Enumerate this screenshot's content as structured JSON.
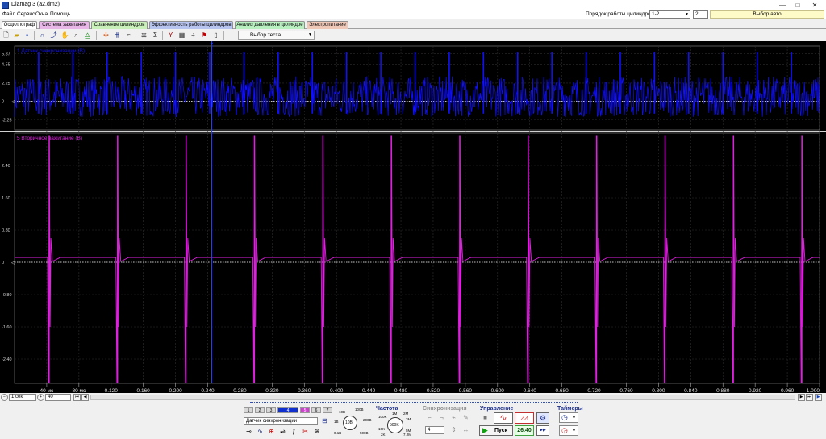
{
  "window": {
    "title": "Diamag 3 (a2.dm2)",
    "minimize": "—",
    "maximize": "□",
    "close": "✕"
  },
  "menu": [
    {
      "label": "Файл"
    },
    {
      "label": "Сервис"
    },
    {
      "label": "Окна"
    },
    {
      "label": "Помощь"
    }
  ],
  "header": {
    "order_label": "Порядок работы цилиндров",
    "order_value": "1-2",
    "cylinders": "2",
    "auto_button": "Выбор авто"
  },
  "tabs": [
    {
      "label": "Осциллограф",
      "color": "#ffffff"
    },
    {
      "label": "Система зажигания",
      "color": "#e8b7e8"
    },
    {
      "label": "Сравнение цилиндров",
      "color": "#c8f0b8"
    },
    {
      "label": "Эффективность работы цилиндров",
      "color": "#b8c4f0"
    },
    {
      "label": "Анализ давления в цилиндре",
      "color": "#b8f0c0"
    },
    {
      "label": "Электропитание",
      "color": "#f0c8b8"
    }
  ],
  "toolbar": {
    "test_select": "Выбор теста"
  },
  "chart_data": [
    {
      "type": "line",
      "title": "1 Датчик синхронизации (В)",
      "series": [
        {
          "name": "1 Датчик синхронизации (В)",
          "color": "#1010ff"
        }
      ],
      "y_ticks": [
        "5.87",
        "4.55",
        "2.25",
        "0",
        "-2.25"
      ],
      "ylim": [
        -3.5,
        6.8
      ],
      "baseline": 0
    },
    {
      "type": "line",
      "title": "5 Вторичное зажигание (В)",
      "series": [
        {
          "name": "5 Вторичное зажигание (В)",
          "color": "#e020e0"
        }
      ],
      "y_ticks": [
        "2.40",
        "1.60",
        "0.80",
        "0",
        "-0.80",
        "-1.60",
        "-2.40"
      ],
      "ylim": [
        -3.0,
        3.2
      ],
      "baseline": 0,
      "spark_times": [
        0.043,
        0.128,
        0.213,
        0.298,
        0.383,
        0.468,
        0.553,
        0.638,
        0.723,
        0.808,
        0.893,
        0.978
      ]
    }
  ],
  "x_axis": {
    "range": [
      0,
      1.0
    ],
    "cursor_time": 0.245,
    "tick_labels": [
      "40 мс",
      "80 мс",
      "0.120",
      "0.160",
      "0.200",
      "0.240",
      "0.280",
      "0.320",
      "0.360",
      "0.400",
      "0.440",
      "0.480",
      "0.520",
      "0.560",
      "0.600",
      "0.640",
      "0.680",
      "0.720",
      "0.760",
      "0.800",
      "0.840",
      "0.880",
      "0.920",
      "0.960",
      "1.000"
    ]
  },
  "zoombar": {
    "timebase": "1 сек",
    "zoom": "40"
  },
  "controls": {
    "sync_source": "Датчик синхронизации",
    "knob1": {
      "value": "10В",
      "labels": [
        "10В",
        "100В",
        "1В",
        "200В",
        "0.1В",
        "500В"
      ]
    },
    "freq_title": "Частота",
    "knob2": {
      "value": "500K",
      "labels": [
        "1M",
        "2M",
        "100K",
        "3M",
        "10K",
        "5M",
        "2K",
        "7.2M"
      ]
    },
    "sync_title": "Синхронизация",
    "sync_value": "4",
    "control_title": "Управление",
    "start_button": "Пуск",
    "rpm_value": "26.40",
    "timers_title": "Таймеры"
  }
}
